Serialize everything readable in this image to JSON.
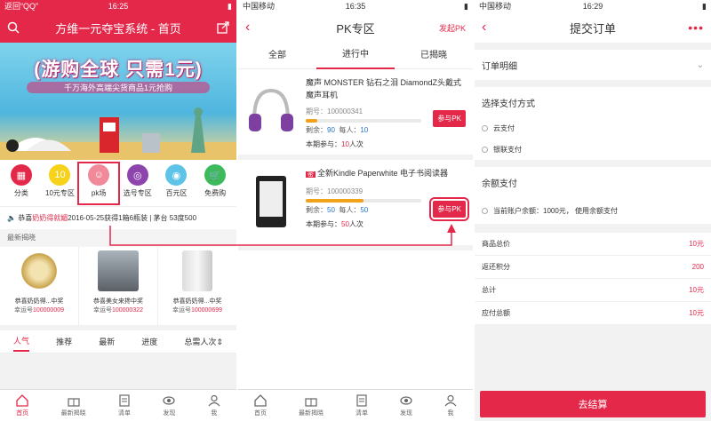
{
  "screen1": {
    "status": {
      "left": "返回“QQ”",
      "time": "16:25"
    },
    "title": "方维一元夺宝系统 - 首页",
    "banner": {
      "headline": "(游购全球 只需1元)",
      "sub": "千万海外高端尖货商品1元抢购"
    },
    "icons": [
      {
        "label": "分类",
        "color": "#e3284a"
      },
      {
        "label": "10元专区",
        "color": "#f6d21b"
      },
      {
        "label": "pk场",
        "color": "#f08a9a"
      },
      {
        "label": "选号专区",
        "color": "#8e44ad"
      },
      {
        "label": "百元区",
        "color": "#5dc3e7"
      },
      {
        "label": "免费购",
        "color": "#3dbb5c"
      }
    ],
    "ticker": {
      "prefix": "恭喜",
      "name": "奶奶得就媚",
      "rest": "2016-05-25获得1箱6瓶装 | 茅台 53度500"
    },
    "latest_title": "最新揭晓",
    "latest": [
      {
        "title": "恭喜奶奶得...中奖",
        "lucky_label": "幸运号",
        "lucky": "100000009"
      },
      {
        "title": "恭喜美女来搀中奖",
        "lucky_label": "幸运号",
        "lucky": "100000322"
      },
      {
        "title": "恭喜奶奶得...中奖",
        "lucky_label": "幸运号",
        "lucky": "100000699"
      }
    ],
    "tabs": [
      "人气",
      "推荐",
      "最新",
      "进度",
      "总需人次"
    ],
    "tabbar": [
      "首页",
      "最新揭晓",
      "清单",
      "发现",
      "我"
    ]
  },
  "screen2": {
    "status": {
      "left": "中国移动",
      "time": "16:35"
    },
    "title": "PK专区",
    "right_action": "发起PK",
    "segments": [
      "全部",
      "进行中",
      "已揭晓"
    ],
    "products": [
      {
        "tag": "",
        "name": "魔声 MONSTER 钻石之泪 DiamondZ头戴式魔声耳机",
        "period_label": "期号：",
        "period": "100000341",
        "progress": 0.1,
        "remain_label": "剩余：",
        "remain": "90",
        "people_label": "每人：",
        "people": "10",
        "part_label": "本期参与：",
        "part": "10",
        "part_unit": "人次",
        "btn": "参与PK"
      },
      {
        "tag": "密",
        "name": "全新Kindle Paperwhite 电子书阅读器",
        "period_label": "期号：",
        "period": "100000339",
        "progress": 0.5,
        "remain_label": "剩余：",
        "remain": "50",
        "people_label": "每人：",
        "people": "50",
        "part_label": "本期参与：",
        "part": "50",
        "part_unit": "人次",
        "btn": "参与PK"
      }
    ],
    "tabbar": [
      "首页",
      "最新揭晓",
      "清单",
      "发现",
      "我"
    ]
  },
  "screen3": {
    "status": {
      "left": "中国移动",
      "time": "16:29"
    },
    "title": "提交订单",
    "order_detail": "订单明细",
    "pay_method": "选择支付方式",
    "pay_options": [
      "云支付",
      "银联支付"
    ],
    "balance_title": "余额支付",
    "balance_text": "当前账户余额：1000元，  使用余额支付",
    "rows": [
      {
        "k": "商品总价",
        "v": "10元"
      },
      {
        "k": "返还积分",
        "v": "200"
      },
      {
        "k": "总计",
        "v": "10元"
      },
      {
        "k": "应付总额",
        "v": "10元"
      }
    ],
    "submit": "去结算"
  }
}
